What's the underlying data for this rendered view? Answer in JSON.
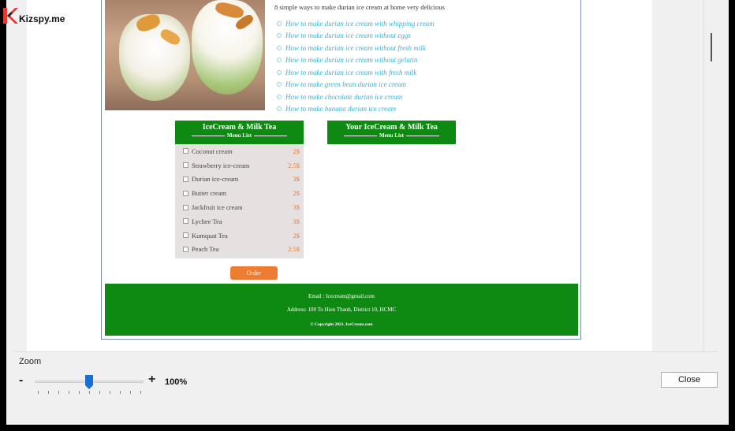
{
  "brand": {
    "name": "Kizspy.me",
    "logo_icon": "kizspy-k-logo-icon",
    "logo_color": "#e53935"
  },
  "page": {
    "intro": "8 simple ways to make durian ice cream at home very delicious",
    "links": [
      "How to make durian ice cream with whipping cream",
      "How to make durian ice cream without eggs",
      "How to make durian ice cream without fresh milk",
      "How to make durian ice cream without gelatin",
      "How to make durian ice cream with fresh milk",
      "How to make green bean durian ice cream",
      "How to make chocolate durian ice cream",
      "How to make banana durian ice cream"
    ],
    "menu": {
      "title": "IceCream & Milk Tea",
      "subtitle": "Menu List",
      "items": [
        {
          "name": "Coconut cream",
          "price": "2$"
        },
        {
          "name": "Strawberry ice-cream",
          "price": "2.5$"
        },
        {
          "name": "Durian ice-cream",
          "price": "3$"
        },
        {
          "name": "Butter cream",
          "price": "2$"
        },
        {
          "name": "Jackfruit ice cream",
          "price": "3$"
        },
        {
          "name": "Lychee Tea",
          "price": "3$"
        },
        {
          "name": "Kumquat Tea",
          "price": "2$"
        },
        {
          "name": "Peach Tea",
          "price": "2.5$"
        }
      ]
    },
    "your_menu": {
      "title": "Your IceCream & Milk Tea",
      "subtitle": "Menu List"
    },
    "order_label": "Order",
    "footer": {
      "email": "Email : Icecream@gmail.com",
      "address": "Address: 100 To Hien Thanh, District 10, HCMC",
      "copyright": "© Copyright 2021. IceCream.com"
    },
    "colors": {
      "green": "#0e8a12",
      "link": "#3bb2d6",
      "price": "#e07a3c",
      "order": "#ee7d34"
    }
  },
  "viewer": {
    "zoom_label": "Zoom",
    "minus": "-",
    "plus": "+",
    "zoom_value": "100%",
    "zoom_level": 100,
    "close_label": "Close",
    "slider_color": "#1a6fd0"
  }
}
